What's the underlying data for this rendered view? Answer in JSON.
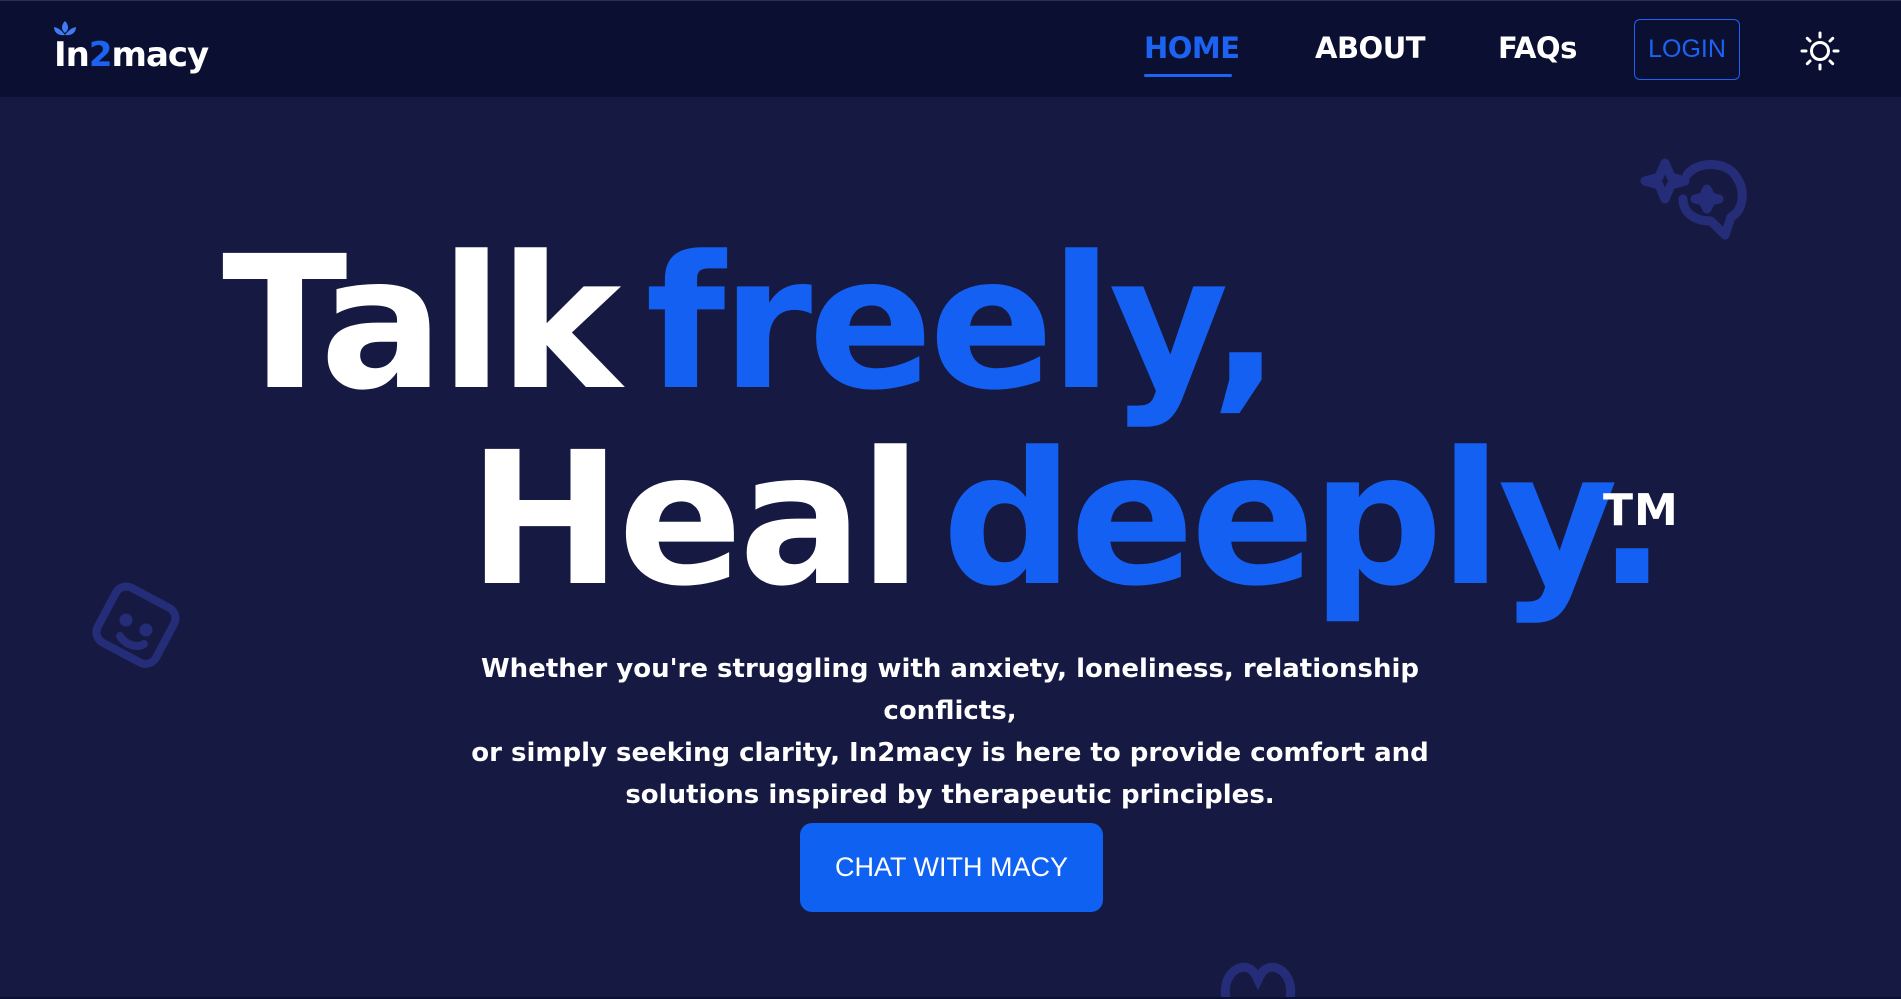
{
  "brand": {
    "logo_prefix": "In",
    "logo_digit": "2",
    "logo_suffix": "macy"
  },
  "nav": {
    "items": [
      {
        "label": "HOME",
        "active": true
      },
      {
        "label": "ABOUT",
        "active": false
      },
      {
        "label": "FAQs",
        "active": false
      }
    ],
    "login_label": "LOGIN",
    "theme_icon": "sun-icon"
  },
  "hero": {
    "line1_white": "Talk",
    "line1_blue": "freely,",
    "line2_white": "Heal",
    "line2_blue": "deeply.",
    "trademark": "TM",
    "subtitle_line1": "Whether you're struggling with anxiety, loneliness, relationship conflicts,",
    "subtitle_line2": "or simply seeking clarity, In2macy is here to provide comfort and",
    "subtitle_line3": "solutions inspired by therapeutic principles.",
    "cta_label": "CHAT WITH MACY"
  },
  "colors": {
    "background": "#161a42",
    "navbar": "#0b1033",
    "accent": "#1460f2",
    "text": "#ffffff"
  }
}
